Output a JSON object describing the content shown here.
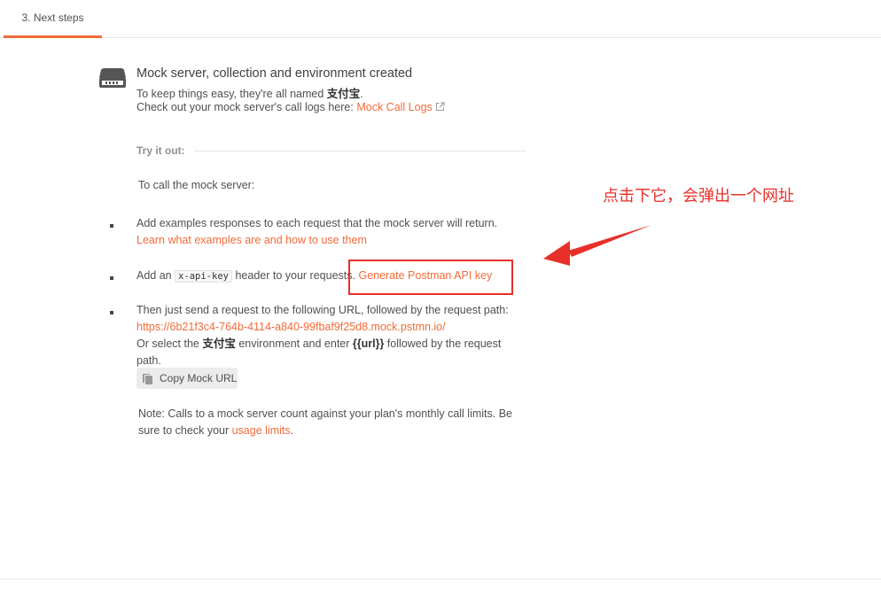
{
  "tabs": {
    "active_label": "3. Next steps"
  },
  "header": {
    "title": "Mock server, collection and environment created",
    "line1_prefix": "To keep things easy, they're all named ",
    "name": "支付宝",
    "line1_suffix": ".",
    "line2_prefix": "Check out your mock server's call logs here: ",
    "logs_link": "Mock Call Logs"
  },
  "try_it": {
    "label": "Try it out:",
    "call_text": "To call the mock server:"
  },
  "steps": [
    {
      "text": "Add examples responses to each request that the mock server will return.",
      "link": "Learn what examples are and how to use them"
    },
    {
      "prefix": "Add an ",
      "code": "x-api-key",
      "suffix": " header to your requests.",
      "link": "Generate Postman API key"
    },
    {
      "text": "Then just send a request to the following URL, followed by the request path:",
      "url": "https://6b21f3c4-764b-4114-a840-99fbaf9f25d8.mock.pstmn.io/",
      "or_prefix": "Or select the ",
      "env_name": "支付宝",
      "or_middle": " environment and enter ",
      "var": "{{url}}",
      "or_suffix": " followed by the request path."
    }
  ],
  "copy_button": {
    "label": "Copy Mock URL"
  },
  "note": {
    "text": "Note: Calls to a mock server count against your plan's monthly call limits. Be sure to check your ",
    "link": "usage limits",
    "suffix": "."
  },
  "annotation": {
    "text": "点击下它，会弹出一个网址",
    "color": "#e8302a"
  },
  "colors": {
    "accent": "#f26b3a",
    "annotation": "#e8302a"
  },
  "icons": [
    "server-icon",
    "external-link-icon",
    "copy-icon",
    "arrow-annotation"
  ]
}
